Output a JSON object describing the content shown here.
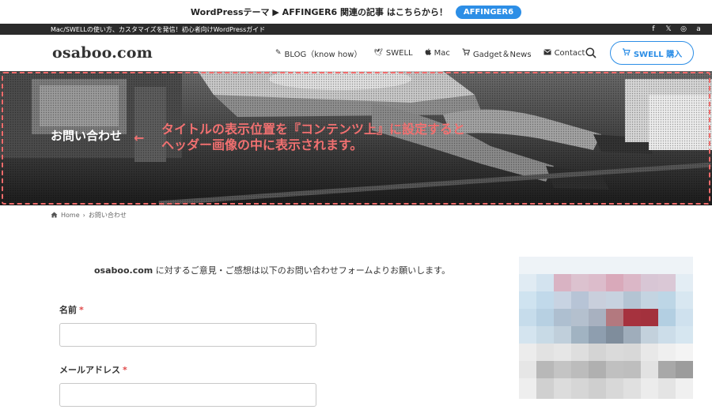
{
  "announcement": {
    "text": "WordPressテーマ ▶ AFFINGER6 関連の記事 はこちらから！",
    "button_label": "AFFINGER6",
    "button_color": "#2c8ee6"
  },
  "subbar": {
    "tagline": "Mac/SWELLの使い方、カスタマイズを発信！初心者向けWordPressガイド",
    "social_icons": [
      "facebook-icon",
      "x-icon",
      "instagram-icon",
      "amazon-icon"
    ],
    "social_glyphs": [
      "f",
      "𝕏",
      "◎",
      "a"
    ]
  },
  "header": {
    "logo": "osaboo.com",
    "nav": [
      {
        "icon": "pen-icon",
        "glyph": "✎",
        "label": "BLOG（know how）"
      },
      {
        "icon": "bird-icon",
        "glyph": "🕊",
        "label": "SWELL"
      },
      {
        "icon": "apple-icon",
        "glyph": "",
        "label": "Mac"
      },
      {
        "icon": "cart-icon",
        "glyph": "🛒",
        "label": "Gadget＆News"
      },
      {
        "icon": "mail-icon",
        "glyph": "✉",
        "label": "Contact"
      }
    ],
    "cta_label": "SWELL 購入",
    "cta_icon_glyph": "🛒"
  },
  "hero": {
    "title": "お問い合わせ",
    "arrow": "←",
    "note_line1": "タイトルの表示位置を『コンテンツ上』に設定すると",
    "note_line2": "ヘッダー画像の中に表示されます。",
    "annotation_color": "#f06b6b"
  },
  "breadcrumb": {
    "home_glyph": "⌂",
    "home": "Home",
    "separator": "›",
    "current": "お問い合わせ"
  },
  "content": {
    "intro_site": "osaboo.com",
    "intro_text": " に対するご意見・ご感想は以下のお問い合わせフォームよりお願いします。",
    "fields": [
      {
        "label": "名前",
        "required": "*",
        "value": ""
      },
      {
        "label": "メールアドレス",
        "required": "*",
        "value": ""
      }
    ]
  }
}
